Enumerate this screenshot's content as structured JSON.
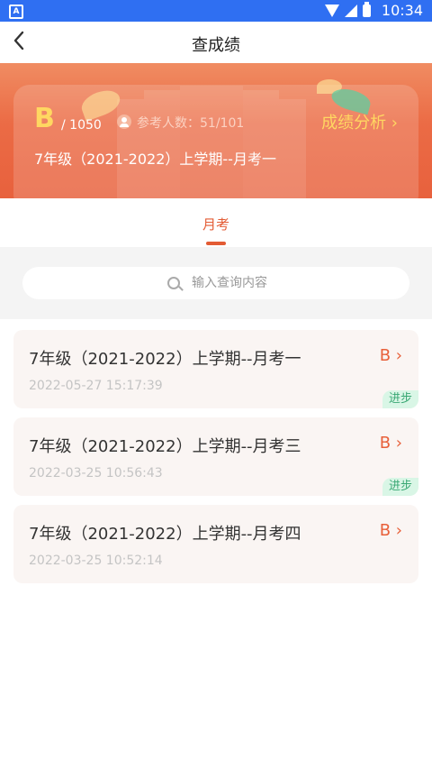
{
  "status_bar": {
    "time": "10:34",
    "icons": [
      "app-icon",
      "wifi-icon",
      "signal-icon",
      "battery-icon"
    ]
  },
  "header": {
    "title": "查成绩",
    "back_icon": "chevron-left-icon"
  },
  "summary": {
    "grade": "B",
    "total": "/ 1050",
    "participants": "参考人数：51/101",
    "analysis_link": "成绩分析 ›",
    "exam_name": "7年级（2021-2022）上学期--月考一"
  },
  "tabs": [
    {
      "label": "月考",
      "active": true
    }
  ],
  "search": {
    "placeholder": "输入查询内容",
    "value": ""
  },
  "exams": [
    {
      "name": "7年级（2021-2022）上学期--月考一",
      "date": "2022-05-27 15:17:39",
      "grade": "B ›",
      "badge": "进步"
    },
    {
      "name": "7年级（2021-2022）上学期--月考三",
      "date": "2022-03-25 10:56:43",
      "grade": "B ›",
      "badge": "进步"
    },
    {
      "name": "7年级（2021-2022）上学期--月考四",
      "date": "2022-03-25 10:52:14",
      "grade": "B ›",
      "badge": ""
    }
  ],
  "colors": {
    "status_bar": "#2f6ff2",
    "accent": "#e35b34",
    "grade_highlight": "#ffd761",
    "progress_badge": "#3aa874"
  }
}
